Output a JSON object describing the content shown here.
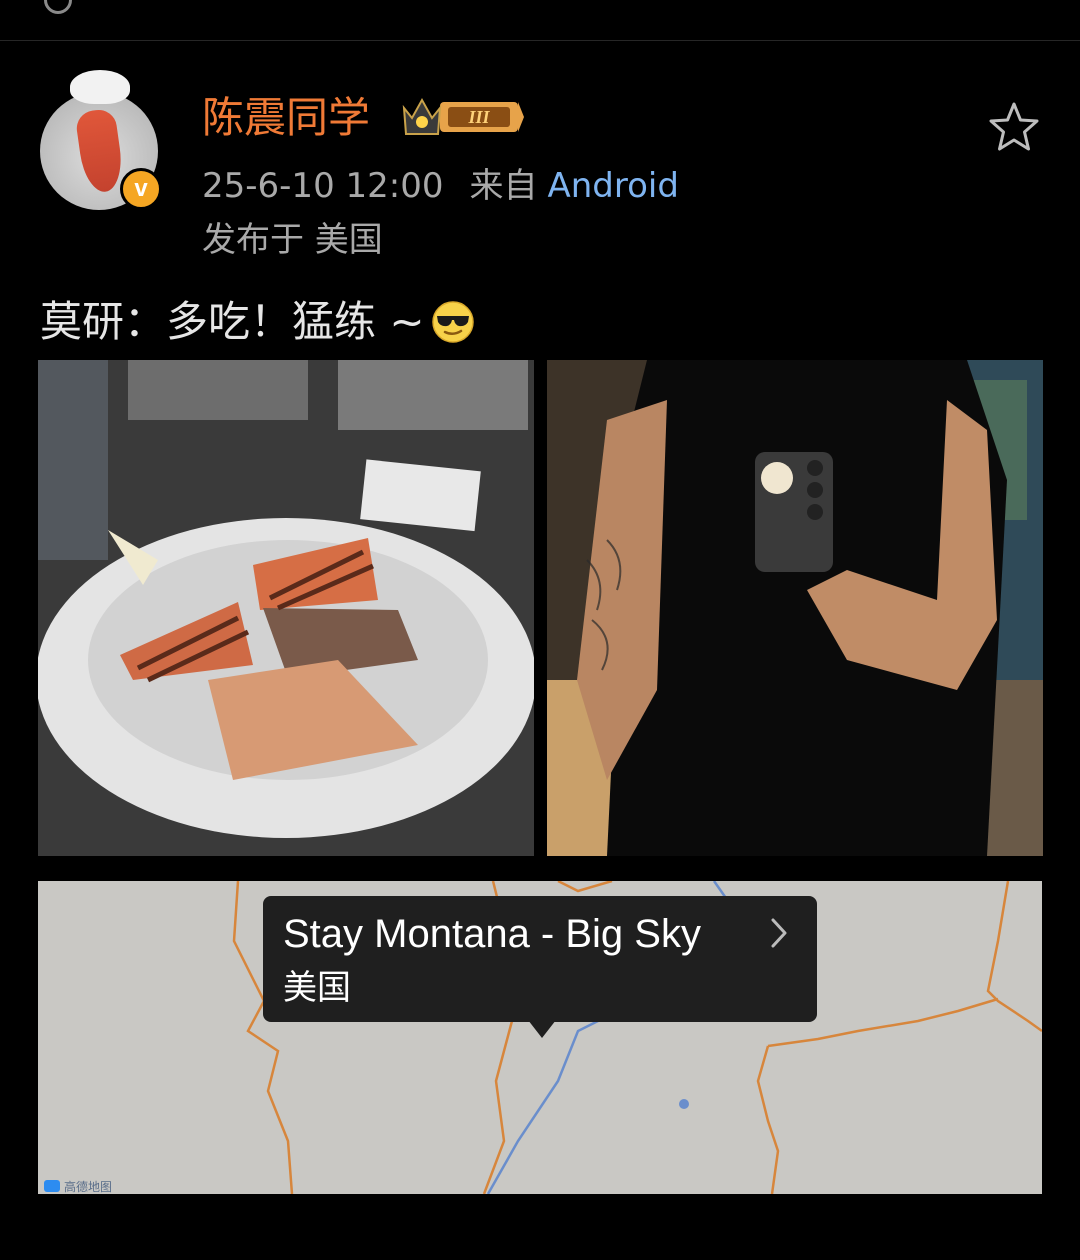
{
  "topbar": {
    "label": "—"
  },
  "post": {
    "author": "陈震同学",
    "rank_badge": "III",
    "timestamp": "25-6-10 12:00",
    "from_label": "来自",
    "client": "Android",
    "location_line": "发布于 美国",
    "text": "莫研：多吃！猛练 ~",
    "emoji": "sunglasses-face"
  },
  "images": [
    {
      "name": "food-plate-photo"
    },
    {
      "name": "gym-mirror-selfie-photo"
    }
  ],
  "map": {
    "place_name": "Stay Montana - Big Sky",
    "country": "美国",
    "provider_label": "高德地图"
  },
  "colors": {
    "background": "#000000",
    "username": "#f07a36",
    "meta": "#a9a9a9",
    "link": "#7fb4f0",
    "badge_orange": "#f5a623"
  }
}
